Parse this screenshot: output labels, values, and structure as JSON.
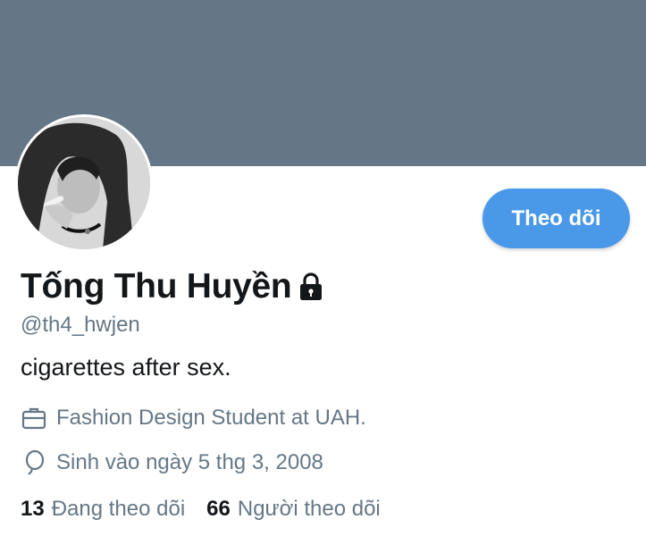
{
  "profile": {
    "display_name": "Tống Thu Huyền",
    "handle": "@th4_hwjen",
    "bio": "cigarettes after sex.",
    "job": "Fashion Design Student at UAH.",
    "birthday": "Sinh vào ngày 5 thg 3, 2008",
    "protected_icon": "lock-icon",
    "job_icon": "briefcase-icon",
    "birthday_icon": "balloon-icon"
  },
  "actions": {
    "follow_label": "Theo dõi"
  },
  "stats": {
    "following_count": "13",
    "following_label": "Đang theo dõi",
    "followers_count": "66",
    "followers_label": "Người theo dõi"
  },
  "colors": {
    "banner": "#657786",
    "accent": "#4a99e9",
    "text_primary": "#14171a",
    "text_secondary": "#657786"
  }
}
